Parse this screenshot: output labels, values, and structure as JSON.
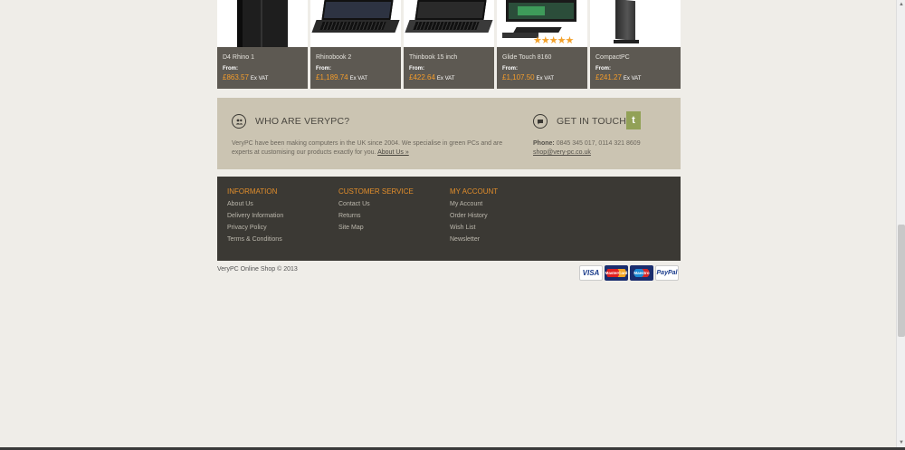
{
  "products": [
    {
      "name": "D4 Rhino 1",
      "from": "From:",
      "price": "£863.57",
      "vat": "Ex VAT"
    },
    {
      "name": "Rhinobook 2",
      "from": "From:",
      "price": "£1,189.74",
      "vat": "Ex VAT"
    },
    {
      "name": "Thinbook 15 inch",
      "from": "From:",
      "price": "£422.64",
      "vat": "Ex VAT"
    },
    {
      "name": "Glide Touch 8160",
      "from": "From:",
      "price": "£1,107.50",
      "vat": "Ex VAT",
      "rating": 5
    },
    {
      "name": "CompactPC",
      "from": "From:",
      "price": "£241.27",
      "vat": "Ex VAT"
    }
  ],
  "about": {
    "title": "WHO ARE VERYPC?",
    "text": "VeryPC have been making computers in the UK since 2004. We specialise in green PCs and are experts at customising our products exactly for you.",
    "link": "About Us »"
  },
  "contact": {
    "title": "GET IN TOUCH",
    "phone_label": "Phone:",
    "phone": "0845 345 017, 0114 321 8609",
    "email": "shop@very-pc.co.uk",
    "twitter_glyph": "t"
  },
  "footer": {
    "columns": [
      {
        "heading": "INFORMATION",
        "links": [
          "About Us",
          "Delivery Information",
          "Privacy Policy",
          "Terms & Conditions"
        ]
      },
      {
        "heading": "CUSTOMER SERVICE",
        "links": [
          "Contact Us",
          "Returns",
          "Site Map"
        ]
      },
      {
        "heading": "MY ACCOUNT",
        "links": [
          "My Account",
          "Order History",
          "Wish List",
          "Newsletter"
        ]
      }
    ]
  },
  "copyright": "VeryPC Online Shop © 2013",
  "payment": {
    "visa": "VISA",
    "mastercard": "MasterCard",
    "maestro": "Maestro",
    "paypal": "PayPal"
  },
  "colors": {
    "accent": "#f39c2b",
    "footer_bg": "#3b3934",
    "about_bg": "#cbc4b2",
    "product_info_bg": "#5d5952",
    "twitter": "#92a157"
  }
}
